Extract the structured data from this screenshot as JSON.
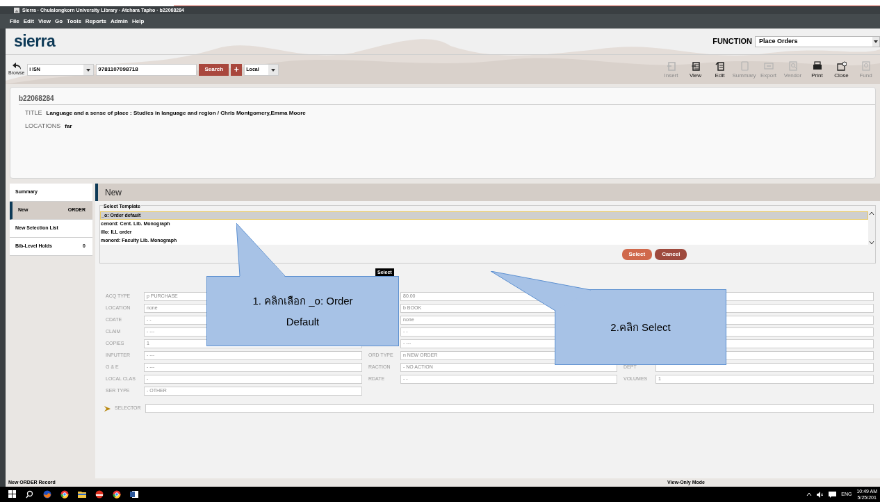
{
  "window": {
    "title": "Sierra · Chulalongkorn University Library · Atchara Tapho · b22068284"
  },
  "menu": [
    "File",
    "Edit",
    "View",
    "Go",
    "Tools",
    "Reports",
    "Admin",
    "Help"
  ],
  "logo": "sierra",
  "function": {
    "label": "FUNCTION",
    "value": "Place Orders"
  },
  "search": {
    "browse": "Browse",
    "index": "i  ISN",
    "query": "9781107098718",
    "button": "Search",
    "plus": "+",
    "scope": "Local"
  },
  "toolbar": [
    {
      "label": "Insert",
      "disabled": true
    },
    {
      "label": "View",
      "disabled": false
    },
    {
      "label": "Edit",
      "disabled": false
    },
    {
      "label": "Summary",
      "disabled": true
    },
    {
      "label": "Export",
      "disabled": true
    },
    {
      "label": "Vendor",
      "disabled": true
    },
    {
      "label": "Print",
      "disabled": false
    },
    {
      "label": "Close",
      "disabled": false
    },
    {
      "label": "Fund",
      "disabled": true
    }
  ],
  "record": {
    "id": "b22068284",
    "fields": [
      {
        "label": "TITLE",
        "value": "Language and a sense of place : Studies in language and region / Chris Montgomery,Emma Moore"
      },
      {
        "label": "LOCATIONS",
        "value": "far"
      }
    ]
  },
  "sidebar": [
    {
      "label": "Summary",
      "selected": false
    },
    {
      "label": "New",
      "count": "ORDER",
      "selected": true
    },
    {
      "label": "New Selection List",
      "selected": false
    },
    {
      "label": "Bib-Level Holds",
      "count": "0",
      "selected": false
    }
  ],
  "panel": {
    "title": "New",
    "template_legend": "Select Template",
    "templates": [
      {
        "code": "_o:",
        "name": "Order default",
        "selected": true
      },
      {
        "code": "cenord:",
        "name": "Cent. Lib. Monograph",
        "selected": false
      },
      {
        "code": "illo:",
        "name": "ILL order",
        "selected": false
      },
      {
        "code": "monord:",
        "name": "Faculty Lib. Monograph",
        "selected": false
      }
    ],
    "buttons": [
      "Select",
      "Cancel"
    ],
    "tooltip": "Select"
  },
  "form": {
    "columns": [
      [
        {
          "label": "ACQ TYPE",
          "value": "p  PURCHASE"
        },
        {
          "label": "LOCATION",
          "value": "none"
        },
        {
          "label": "CDATE",
          "value": "-  -"
        },
        {
          "label": "CLAIM",
          "value": "-  ---"
        },
        {
          "label": "COPIES",
          "value": "1"
        },
        {
          "label": "INPUTTER",
          "value": "-  ---"
        },
        {
          "label": "G & E",
          "value": "-  ---"
        },
        {
          "label": "LOCAL CLAS",
          "value": "-"
        },
        {
          "label": "SER TYPE",
          "value": "-  OTHER"
        }
      ],
      [
        {
          "value": "80.00"
        },
        {
          "value": "b  BOOK"
        },
        {
          "value": "none"
        },
        {
          "value": "-  -"
        },
        {
          "value": "-  ---"
        },
        {
          "label": "ORD TYPE",
          "value": "n  NEW ORDER"
        },
        {
          "label": "RACTION",
          "value": "-  NO ACTION"
        },
        {
          "label": "RDATE",
          "value": "-  -"
        }
      ],
      [
        {},
        {},
        {},
        {},
        {},
        {},
        {
          "label": "DEPT"
        },
        {
          "label": "VOLUMES",
          "value": "1"
        }
      ]
    ],
    "selector": "SELECTOR"
  },
  "callouts": [
    {
      "text": "1. คลิกเลือก _o: Order Default"
    },
    {
      "text": "2.คลิก Select"
    }
  ],
  "status": {
    "left": "New ORDER Record",
    "center": "View-Only Mode"
  },
  "taskbar": {
    "lang": "ENG",
    "time": "10:49 AM",
    "date": "5/25/201"
  }
}
